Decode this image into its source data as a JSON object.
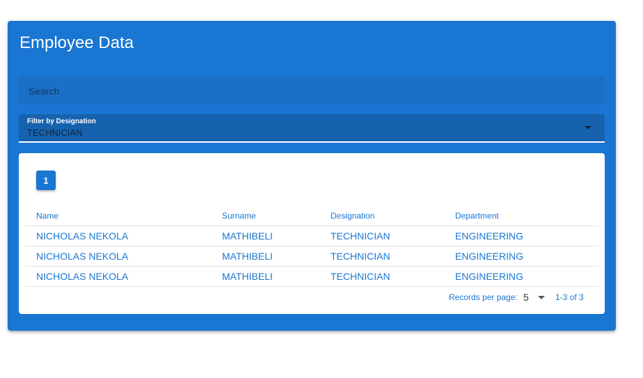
{
  "card": {
    "title": "Employee Data"
  },
  "search": {
    "placeholder": "Search",
    "value": ""
  },
  "filter": {
    "label": "Filter by Designation",
    "value": "TECHNICIAN",
    "arrow_icon": "dropdown-arrow-icon"
  },
  "pagination": {
    "current_page": "1"
  },
  "table": {
    "headers": [
      "Name",
      "Surname",
      "Designation",
      "Department"
    ],
    "rows": [
      [
        "NICHOLAS NEKOLA",
        "MATHIBELI",
        "TECHNICIAN",
        "ENGINEERING"
      ],
      [
        "NICHOLAS NEKOLA",
        "MATHIBELI",
        "TECHNICIAN",
        "ENGINEERING"
      ],
      [
        "NICHOLAS NEKOLA",
        "MATHIBELI",
        "TECHNICIAN",
        "ENGINEERING"
      ]
    ]
  },
  "footer": {
    "records_per_page_label": "Records per page:",
    "records_per_page_value": "5",
    "range": "1-3 of 3"
  },
  "colors": {
    "primary": "#1976d2",
    "background": "#ffffff"
  }
}
